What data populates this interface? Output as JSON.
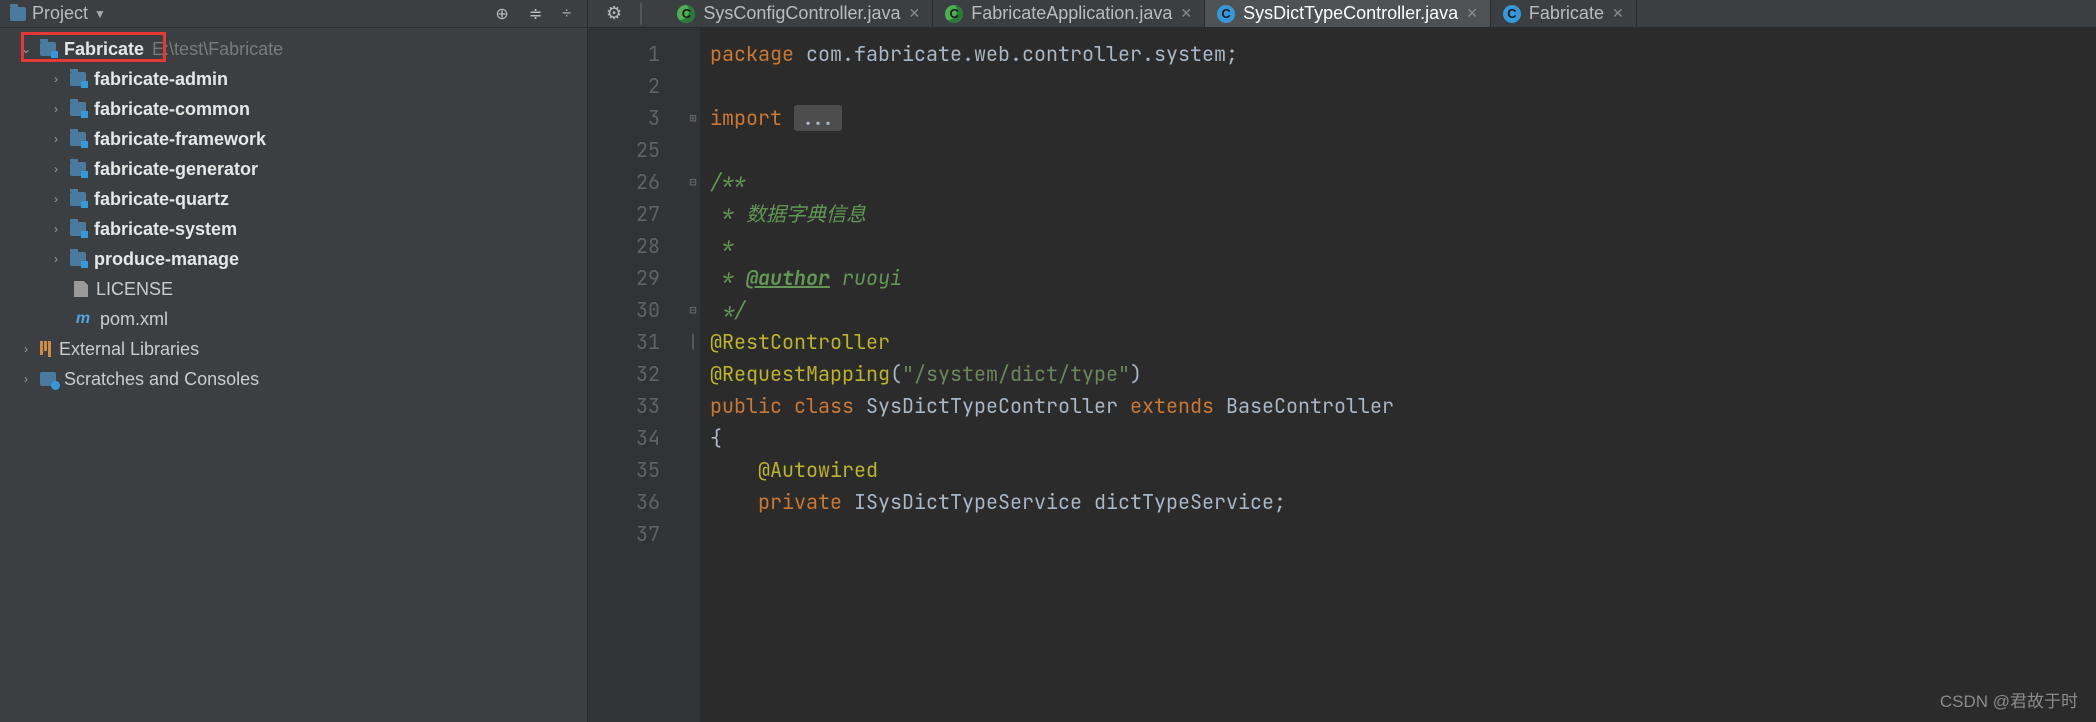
{
  "header": {
    "project_label": "Project"
  },
  "tabs": [
    {
      "label": "SysConfigController.java",
      "icon": "green",
      "active": false
    },
    {
      "label": "FabricateApplication.java",
      "icon": "green",
      "active": false
    },
    {
      "label": "SysDictTypeController.java",
      "icon": "blue",
      "active": true
    },
    {
      "label": "Fabricate",
      "icon": "blue",
      "active": false
    }
  ],
  "tree": {
    "root": {
      "name": "Fabricate",
      "path": "E:\\test\\Fabricate"
    },
    "modules": [
      "fabricate-admin",
      "fabricate-common",
      "fabricate-framework",
      "fabricate-generator",
      "fabricate-quartz",
      "fabricate-system",
      "produce-manage"
    ],
    "root_files": [
      {
        "name": "LICENSE",
        "kind": "license"
      },
      {
        "name": "pom.xml",
        "kind": "maven"
      }
    ],
    "extras": [
      {
        "name": "External Libraries",
        "kind": "lib"
      },
      {
        "name": "Scratches and Consoles",
        "kind": "scratch"
      }
    ]
  },
  "code": {
    "line_numbers": [
      "1",
      "2",
      "3",
      "25",
      "26",
      "27",
      "28",
      "29",
      "30",
      "31",
      "32",
      "33",
      "34",
      "35",
      "36",
      "37"
    ],
    "package_kw": "package",
    "package_name": "com.fabricate.web.controller.system",
    "import_kw": "import",
    "ellipsis": "...",
    "doc_open": "/**",
    "doc_line1": " * 数据字典信息",
    "doc_line2": " *",
    "doc_author_tag": "@author",
    "doc_author_val": " ruoyi",
    "doc_close": " */",
    "ann_rest": "@RestController",
    "ann_reqmap": "@RequestMapping",
    "reqmap_path": "\"/system/dict/type\"",
    "public_kw": "public",
    "class_kw": "class",
    "class_name": "SysDictTypeController",
    "extends_kw": "extends",
    "base_class": "BaseController",
    "brace_open": "{",
    "ann_autowired": "@Autowired",
    "private_kw": "private",
    "field_type": "ISysDictTypeService",
    "field_name": "dictTypeService"
  },
  "watermark": "CSDN @君故于时"
}
